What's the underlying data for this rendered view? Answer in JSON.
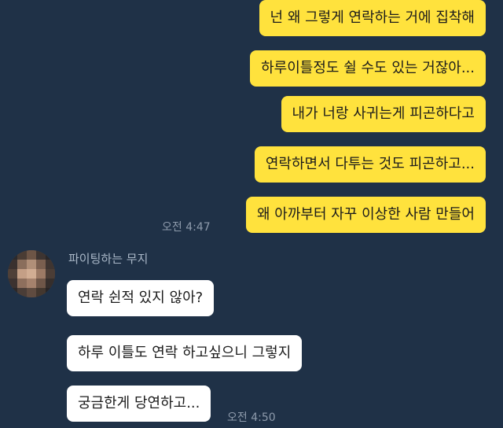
{
  "sent_messages": [
    {
      "text": "넌 왜 그렇게 연락하는 거에 집착해"
    },
    {
      "text": "하루이틀정도 쉴 수도 있는 거잖아..."
    },
    {
      "text": "내가 너랑 사귀는게 피곤하다고"
    },
    {
      "text": "연락하면서 다투는 것도 피곤하고..."
    },
    {
      "text": "왜 아까부터 자꾸 이상한 사람 만들어"
    }
  ],
  "sent_time": "오전 4:47",
  "sender": {
    "name": "파이팅하는 무지",
    "avatar_icon": "blurred-profile-avatar"
  },
  "received_messages": [
    {
      "text": "연락 쉰적 있지 않아?"
    },
    {
      "text": "하루 이틀도 연락 하고싶으니 그렇지"
    },
    {
      "text": "궁금한게 당연하고..."
    }
  ],
  "received_time": "오전 4:50",
  "colors": {
    "background": "#1f3147",
    "sent_bubble": "#ffe23d",
    "received_bubble": "#ffffff",
    "timestamp": "#8d9aab",
    "sender_name": "#a9b7c7"
  }
}
